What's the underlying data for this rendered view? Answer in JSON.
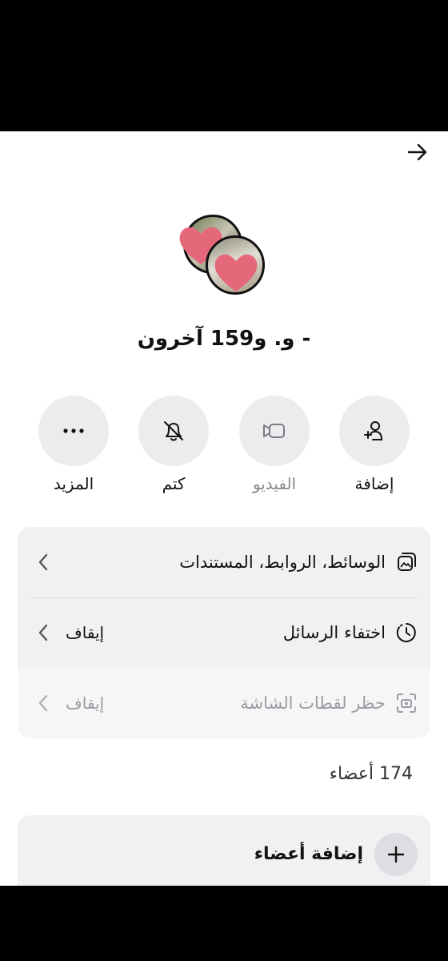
{
  "header": {
    "back_icon": "arrow-right-icon"
  },
  "group": {
    "name": "- و. و159 آخرون",
    "avatar_icons": [
      "avatar-photo",
      "heart-sticker"
    ]
  },
  "actions": [
    {
      "label": "إضافة",
      "icon": "add-person-icon",
      "enabled": true
    },
    {
      "label": "الفيديو",
      "icon": "video-icon",
      "enabled": false
    },
    {
      "label": "كتم",
      "icon": "bell-muted-icon",
      "enabled": true
    },
    {
      "label": "المزيد",
      "icon": "more-dots-icon",
      "enabled": true
    }
  ],
  "settings": {
    "media": {
      "label": "الوسائط، الروابط، المستندات",
      "icon": "media-gallery-icon"
    },
    "disappearing": {
      "label": "اختفاء الرسائل",
      "value": "إيقاف",
      "icon": "timer-icon"
    },
    "screenshot_block": {
      "label": "حظر لقطات الشاشة",
      "value": "إيقاف",
      "icon": "camera-screenshot-icon",
      "enabled": false
    }
  },
  "members": {
    "count_label": "174 أعضاء",
    "add_label": "إضافة أعضاء",
    "add_icon": "plus-icon"
  },
  "colors": {
    "card_bg": "#f1f1f4",
    "circle_bg": "#ececef",
    "heart": "#e5677a"
  }
}
